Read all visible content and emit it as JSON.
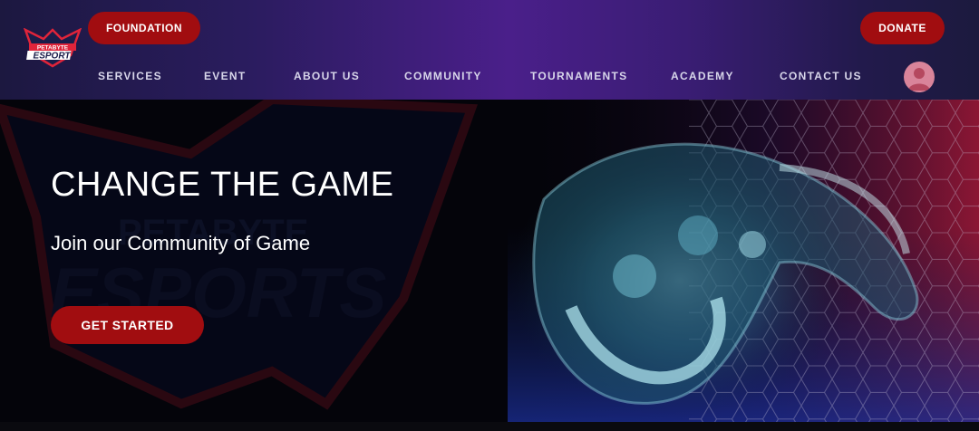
{
  "brand": {
    "logo_line1": "PETABYTE",
    "logo_line2": "ESPORT"
  },
  "header": {
    "foundation_label": "FOUNDATION",
    "donate_label": "DONATE",
    "nav": [
      "SERVICES",
      "EVENT",
      "ABOUT US",
      "COMMUNITY",
      "TOURNAMENTS",
      "ACADEMY",
      "CONTACT US"
    ],
    "avatar_icon": "user-avatar-icon"
  },
  "hero": {
    "title": "CHANGE THE GAME",
    "subtitle": "Join our Community of Game",
    "cta_label": "GET STARTED",
    "watermark_line1": "PETABYTE",
    "watermark_line2": "ESPORTS",
    "background_image": "game-controller-photo"
  },
  "colors": {
    "accent_red": "#a10d10",
    "header_purple": "#4a1f8a",
    "avatar_pink": "#d9849a",
    "hero_dark": "#04040a"
  }
}
